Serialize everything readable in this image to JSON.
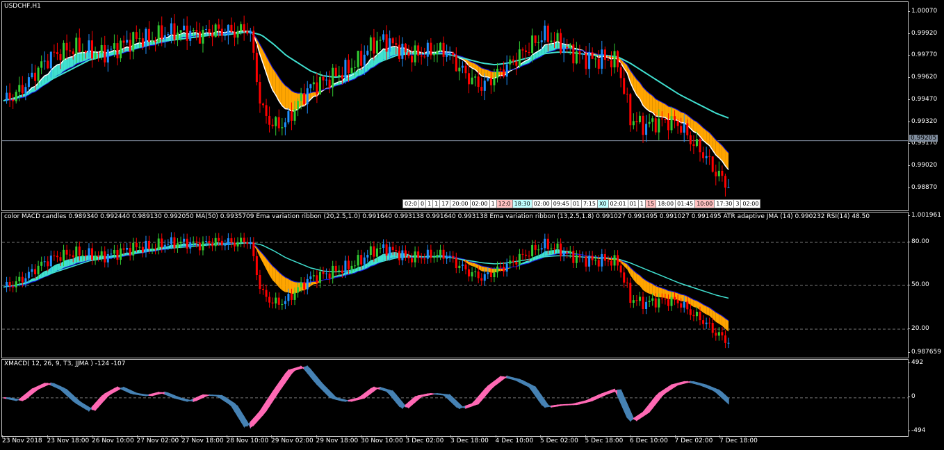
{
  "window": {
    "symbol_label": "USDCHF,H1",
    "current_price": "0.99205"
  },
  "pane2": {
    "label": "color MACD candles 0.989340 0.992440 0.989130 0.992050 MA(50) 0.9935709 Ema variation ribbon (20,2.5,1.0) 0.991640 0.993138 0.991640 0.993138 Ema variation ribbon (13,2.5,1.8) 0.991027 0.991495 0.991027 0.991495 ATR adaptive JMA (14) 0.990232 RSI(14) 48.50",
    "ticks": [
      "1.001961",
      "80.00",
      "50.00",
      "20.00",
      "0.987659"
    ]
  },
  "pane3": {
    "label": "XMACD( 12, 26, 9, T3, JJMA ) -124 -107",
    "ticks": [
      "492",
      "0",
      "-494"
    ]
  },
  "colors": {
    "bull": "#32cd32",
    "bear": "#ff0000",
    "bull_bar": "#1e90ff",
    "ribbon_up": "#40e0d0",
    "ribbon_down": "#ffa500",
    "ma": "#40e0d0",
    "macd_pos": "#ff69b4",
    "macd_neg": "#4682b4"
  },
  "session_boxes": [
    "02:0",
    "0",
    "1",
    "1",
    "17",
    "20:00",
    "02:00",
    "1",
    "12:0",
    "18:30",
    "02:00",
    "09:45",
    "01",
    "7:15",
    "X0",
    "02:01",
    "01",
    "1",
    "15",
    "18:00",
    "01:45",
    "10:00",
    "17:30",
    "3",
    "02:00"
  ],
  "chart_data": {
    "type": "line",
    "symbol": "USDCHF",
    "timeframe": "H1",
    "time_labels": [
      "23 Nov 2018",
      "23 Nov 18:00",
      "26 Nov 10:00",
      "27 Nov 02:00",
      "27 Nov 18:00",
      "28 Nov 10:00",
      "29 Nov 02:00",
      "29 Nov 18:00",
      "30 Nov 10:00",
      "3 Dec 02:00",
      "3 Dec 18:00",
      "4 Dec 10:00",
      "5 Dec 02:00",
      "5 Dec 18:00",
      "6 Dec 10:00",
      "7 Dec 02:00",
      "7 Dec 18:00"
    ],
    "price_ticks": [
      "1.00070",
      "0.99920",
      "0.99770",
      "0.99620",
      "0.99470",
      "0.99320",
      "0.99170",
      "0.99020",
      "0.98870"
    ],
    "price_range": [
      0.9876,
      1.0009
    ],
    "close_approx": [
      0.9946,
      0.995,
      0.9958,
      0.9968,
      0.9975,
      0.9978,
      0.998,
      0.9978,
      0.9976,
      0.9979,
      0.9983,
      0.9986,
      0.9985,
      0.9989,
      0.999,
      0.999,
      0.9988,
      0.9991,
      0.999,
      0.999,
      0.9993,
      0.994,
      0.993,
      0.9932,
      0.9945,
      0.9955,
      0.9958,
      0.9962,
      0.9966,
      0.9972,
      0.9982,
      0.9985,
      0.998,
      0.9975,
      0.9976,
      0.9978,
      0.9978,
      0.9968,
      0.996,
      0.9955,
      0.9962,
      0.9968,
      0.9975,
      0.9982,
      0.9988,
      0.9984,
      0.9978,
      0.9974,
      0.9972,
      0.9973,
      0.997,
      0.9935,
      0.993,
      0.9932,
      0.9933,
      0.9931,
      0.992,
      0.9912,
      0.99,
      0.9892
    ],
    "ma50_approx": [
      0.9946,
      0.9948,
      0.9951,
      0.9955,
      0.996,
      0.9964,
      0.9968,
      0.9972,
      0.9974,
      0.9976,
      0.9978,
      0.998,
      0.9982,
      0.9984,
      0.9985,
      0.9986,
      0.9987,
      0.9988,
      0.9988,
      0.9989,
      0.999,
      0.9988,
      0.9982,
      0.9975,
      0.997,
      0.9965,
      0.9962,
      0.9961,
      0.9962,
      0.9965,
      0.9969,
      0.9972,
      0.9975,
      0.9976,
      0.9976,
      0.9976,
      0.9976,
      0.9974,
      0.9972,
      0.997,
      0.9969,
      0.997,
      0.9972,
      0.9974,
      0.9976,
      0.9977,
      0.9977,
      0.9976,
      0.9975,
      0.9975,
      0.9974,
      0.997,
      0.9965,
      0.996,
      0.9955,
      0.995,
      0.9946,
      0.9942,
      0.9938,
      0.9935
    ],
    "macd_range": [
      -494,
      492
    ],
    "macd_ticks": [
      "492",
      "0",
      "-494"
    ],
    "macd_approx": [
      0,
      -40,
      120,
      210,
      120,
      -60,
      -180,
      40,
      150,
      60,
      30,
      80,
      0,
      -50,
      40,
      30,
      -100,
      -420,
      -200,
      100,
      380,
      440,
      200,
      0,
      -50,
      0,
      150,
      90,
      -150,
      20,
      60,
      40,
      -150,
      -80,
      150,
      300,
      250,
      150,
      -130,
      -100,
      -90,
      -40,
      50,
      120,
      -330,
      -200,
      50,
      180,
      230,
      180,
      100,
      -80
    ],
    "rsi_ticks": [
      "80.00",
      "50.00",
      "20.00"
    ],
    "rsi_value": 48.5
  }
}
